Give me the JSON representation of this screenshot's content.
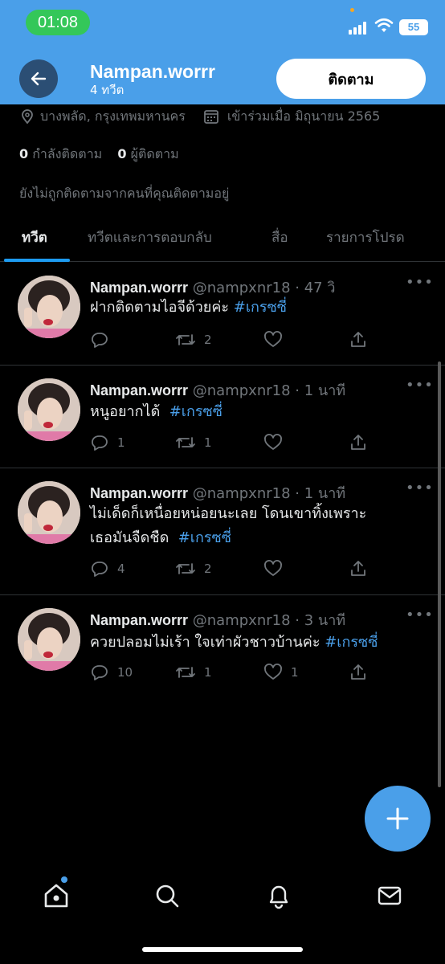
{
  "status_bar": {
    "time": "01:08",
    "battery": "55"
  },
  "header": {
    "name": "Nampan.worrr",
    "tweet_count": "4 ทวีต",
    "follow_label": "ติดตาม"
  },
  "profile": {
    "location": "บางพลัด, กรุงเทพมหานคร",
    "joined": "เข้าร่วมเมื่อ มิถุนายน 2565",
    "following_count": "0",
    "following_label": "กำลังติดตาม",
    "followers_count": "0",
    "followers_label": "ผู้ติดตาม",
    "not_followed_note": "ยังไม่ถูกติดตามจากคนที่คุณติดตามอยู่"
  },
  "tabs": [
    {
      "label": "ทวีต",
      "active": true
    },
    {
      "label": "ทวีตและการตอบกลับ",
      "active": false
    },
    {
      "label": "สื่อ",
      "active": false
    },
    {
      "label": "รายการโปรด",
      "active": false
    }
  ],
  "tweets": [
    {
      "name": "Nampan.worrr",
      "handle": "@nampxnr18",
      "time": "· 47 วิ",
      "text_line1": "ฝากติดตามไอจีด้วยค่ะ ",
      "text_line2": "",
      "hashtag": "#เกรซซี่",
      "replies": "",
      "retweets": "2",
      "likes": ""
    },
    {
      "name": "Nampan.worrr",
      "handle": "@nampxnr18",
      "time": "· 1 นาที",
      "text_line1": "หนูอยากได้  ",
      "text_line2": "",
      "hashtag": "#เกรซซี่",
      "replies": "1",
      "retweets": "1",
      "likes": ""
    },
    {
      "name": "Nampan.worrr",
      "handle": "@nampxnr18",
      "time": "· 1 นาที",
      "text_line1": "ไม่เด็ดก็เหนื่อยหน่อยนะเลย โดนเขาทิ้งเพราะ",
      "text_line2": "เธอมันจืดชืด  ",
      "hashtag": "#เกรซซี่",
      "replies": "4",
      "retweets": "2",
      "likes": ""
    },
    {
      "name": "Nampan.worrr",
      "handle": "@nampxnr18",
      "time": "· 3 นาที",
      "text_line1": "ควยปลอมไม่เร้า ใจเท่าผัวชาวบ้านค่ะ ",
      "text_line2": "",
      "hashtag": "#เกรซซี่",
      "replies": "10",
      "retweets": "1",
      "likes": "1"
    }
  ],
  "icons": {
    "back": "arrow-left-icon",
    "location": "location-pin-icon",
    "calendar": "calendar-icon",
    "more": "more-dots-icon",
    "reply": "reply-icon",
    "retweet": "retweet-icon",
    "like": "heart-icon",
    "share": "share-icon",
    "compose": "plus-icon",
    "home": "home-icon",
    "search": "search-icon",
    "notifications": "bell-icon",
    "messages": "mail-icon"
  },
  "colors": {
    "header_bg": "#4a9fe9",
    "accent": "#1d9bf0",
    "background": "#000000",
    "muted_text": "#71767b"
  }
}
